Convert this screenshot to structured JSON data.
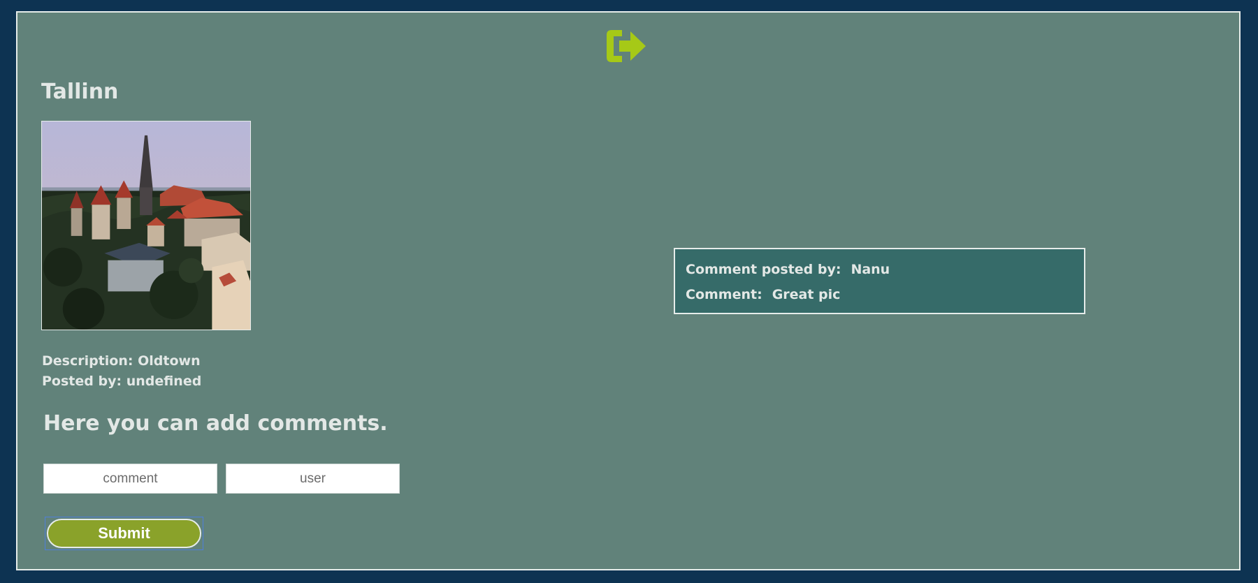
{
  "header": {
    "logout_icon": "logout-icon",
    "logout_icon_color": "#a6c917"
  },
  "post": {
    "title": "Tallinn",
    "photo_alt": "Tallinn",
    "description_label": "Description:",
    "description_value": "Oldtown",
    "posted_by_label": "Posted by:",
    "posted_by_value": "undefined"
  },
  "comment_form": {
    "heading": "Here you can add comments.",
    "comment_placeholder": "comment",
    "user_placeholder": "user",
    "submit_label": "Submit"
  },
  "comments": [
    {
      "author_label": "Comment posted by:",
      "author": "Nanu",
      "text_label": "Comment:",
      "text": "Great pic"
    }
  ],
  "colors": {
    "background": "#0d3352",
    "panel": "#61827a",
    "comment_card": "#366b69",
    "button": "#8aa22a",
    "accent_icon": "#a6c917"
  }
}
